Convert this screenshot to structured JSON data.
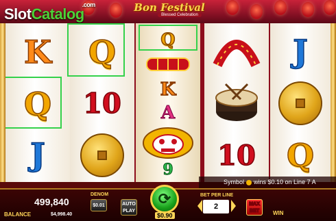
{
  "branding": {
    "site_logo_slot": "Slot",
    "site_logo_catalog": "Catalog",
    "site_logo_com": ".com",
    "game_title": "Bon Festival",
    "game_subtitle": "Blessed Celebration"
  },
  "reels": [
    {
      "symbols": [
        "K",
        "Q",
        "J"
      ],
      "colors": [
        "orange",
        "gold",
        "blue"
      ]
    },
    {
      "symbols": [
        "Q",
        "10",
        "coin"
      ],
      "colors": [
        "gold",
        "red",
        "gold"
      ]
    },
    {
      "symbols": [
        "Q",
        "firecracker",
        "K",
        "A",
        "lion-head",
        "9"
      ],
      "colors": [
        "gold",
        "red",
        "orange",
        "pink",
        "gold",
        "green"
      ]
    },
    {
      "symbols": [
        "firecracker",
        "drum",
        "10"
      ],
      "colors": [
        "red",
        "red",
        "red"
      ]
    },
    {
      "symbols": [
        "J",
        "coin",
        "Q"
      ],
      "colors": [
        "blue",
        "gold",
        "gold"
      ]
    }
  ],
  "win_message": {
    "prefix": "Symbol",
    "text": "wins $0.10 on Line 7 A"
  },
  "controls": {
    "balance_label": "BALANCE",
    "balance_credits": "499,840",
    "balance_cash": "$4,998.40",
    "denom_label": "DENOM",
    "denom_value": "$0.01",
    "autoplay_line1": "AUTO",
    "autoplay_line2": "PLAY",
    "spin_bet": "$0.90",
    "bet_per_line_label": "BET PER LINE",
    "bet_per_line_value": "2",
    "max_bet_line1": "MAX",
    "max_bet_line2": "BET",
    "win_label": "WIN"
  },
  "colors": {
    "accent_gold": "#ffd659",
    "win_highlight": "#33d14a",
    "spin_green": "#18a01a"
  }
}
